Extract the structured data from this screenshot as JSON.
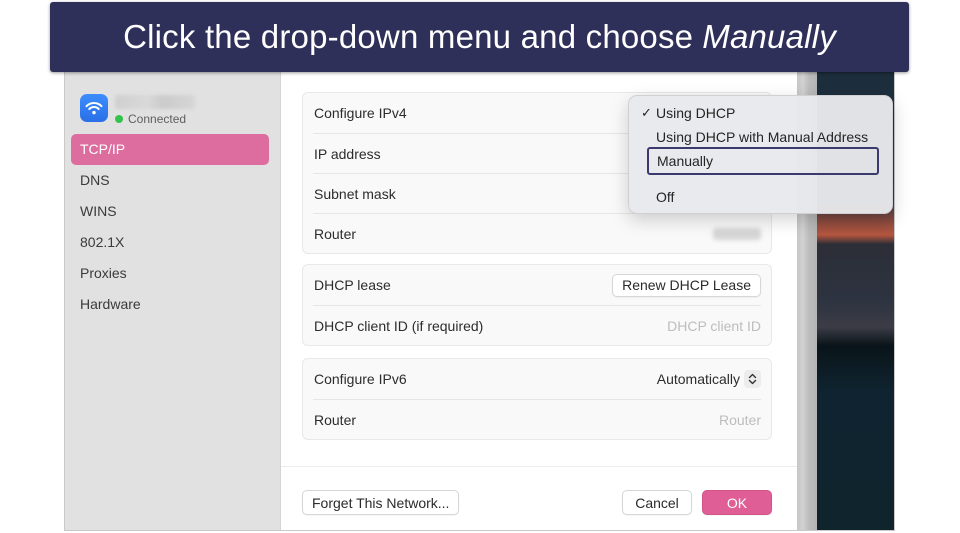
{
  "banner": {
    "text": "Click the drop-down menu and choose",
    "emphasis": "Manually"
  },
  "sidebar": {
    "network": {
      "icon": "wifi-icon",
      "status": "Connected",
      "status_color": "#34c34a"
    },
    "items": [
      {
        "label": "TCP/IP",
        "active": true
      },
      {
        "label": "DNS",
        "active": false
      },
      {
        "label": "WINS",
        "active": false
      },
      {
        "label": "802.1X",
        "active": false
      },
      {
        "label": "Proxies",
        "active": false
      },
      {
        "label": "Hardware",
        "active": false
      }
    ],
    "accent_color": "#de6d9f"
  },
  "ipv4_group": {
    "rows": [
      {
        "label": "Configure IPv4"
      },
      {
        "label": "IP address"
      },
      {
        "label": "Subnet mask"
      },
      {
        "label": "Router"
      }
    ]
  },
  "dhcp_group": {
    "lease_label": "DHCP lease",
    "renew_button": "Renew DHCP Lease",
    "client_id_label": "DHCP client ID (if required)",
    "client_id_placeholder": "DHCP client ID"
  },
  "ipv6_group": {
    "configure_label": "Configure IPv6",
    "configure_value": "Automatically",
    "router_label": "Router",
    "router_placeholder": "Router"
  },
  "footer": {
    "forget_button": "Forget This Network...",
    "cancel_button": "Cancel",
    "ok_button": "OK",
    "ok_color": "#de5e95"
  },
  "dropdown": {
    "options": [
      {
        "label": "Using DHCP",
        "checked": true
      },
      {
        "label": "Using DHCP with Manual Address",
        "checked": false
      },
      {
        "label": "Manually",
        "checked": false,
        "highlighted": true
      },
      {
        "label": "Off",
        "checked": false
      }
    ],
    "check_glyph": "✓",
    "highlight_color": "#3b3a6e"
  }
}
